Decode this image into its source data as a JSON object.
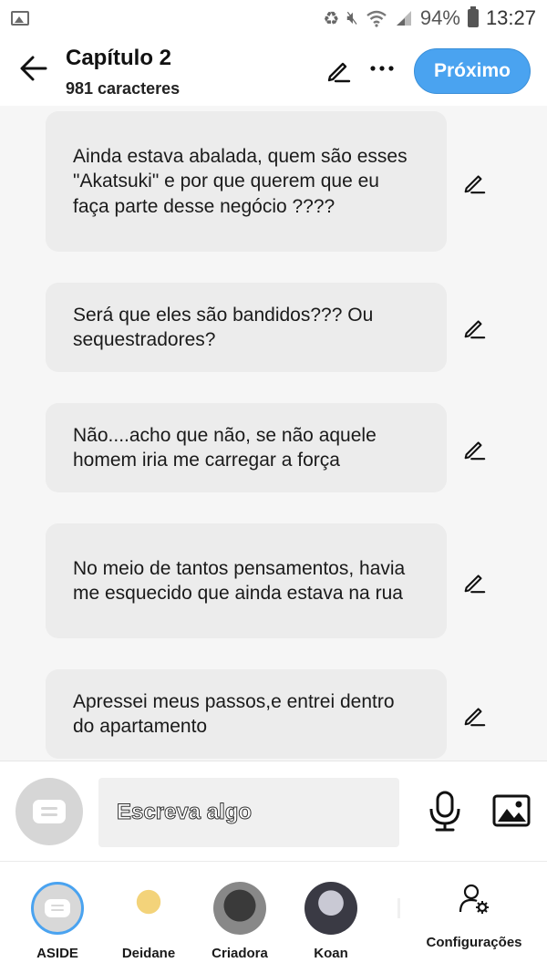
{
  "status_bar": {
    "battery": "94%",
    "time": "13:27",
    "icons": [
      "image-icon",
      "battery-saver-icon",
      "mute-icon",
      "wifi-icon",
      "signal-icon",
      "battery-icon"
    ]
  },
  "header": {
    "title": "Capítulo 2",
    "subtitle": "981 caracteres",
    "next_label": "Próximo",
    "accent": "#4aa3f0"
  },
  "messages": [
    {
      "text": "Ainda estava abalada, quem são esses \"Akatsuki\" e por que querem que eu faça parte desse negócio ????"
    },
    {
      "text": "Será que eles são bandidos??? Ou sequestradores?"
    },
    {
      "text": "Não....acho que não, se não aquele homem iria me carregar a força"
    },
    {
      "text": "No meio de tantos pensamentos, havia me esquecido que ainda estava na rua"
    },
    {
      "text": "Apressei meus passos,e entrei dentro do apartamento"
    }
  ],
  "composer": {
    "placeholder": "Escreva algo"
  },
  "bottom_nav": {
    "items": [
      {
        "label": "ASIDE"
      },
      {
        "label": "Deidane"
      },
      {
        "label": "Criadora"
      },
      {
        "label": "Koan"
      }
    ],
    "settings_label": "Configurações"
  }
}
